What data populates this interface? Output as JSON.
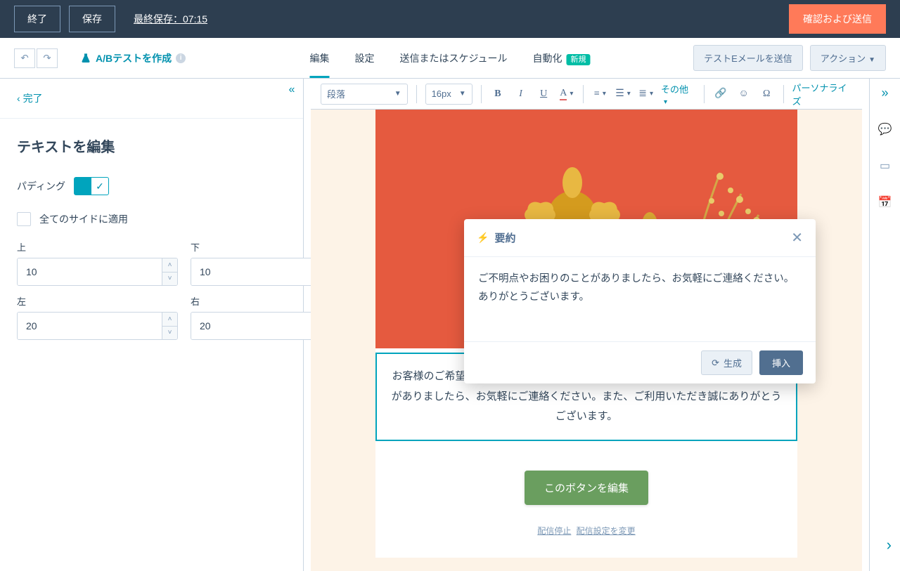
{
  "topbar": {
    "exit": "終了",
    "save": "保存",
    "last_saved": "最終保存：07:15",
    "confirm": "確認および送信"
  },
  "nav": {
    "ab_test": "A/Bテストを作成",
    "tabs": {
      "edit": "編集",
      "settings": "設定",
      "schedule": "送信またはスケジュール",
      "automate": "自動化"
    },
    "new_badge": "新規",
    "test_email": "テストEメールを送信",
    "actions": "アクション"
  },
  "sidebar": {
    "back": "完了",
    "title": "テキストを編集",
    "padding_label": "パディング",
    "apply_all": "全てのサイドに適用",
    "fields": {
      "top": "上",
      "bottom": "下",
      "left": "左",
      "right": "右"
    },
    "values": {
      "top": "10",
      "bottom": "10",
      "left": "20",
      "right": "20"
    }
  },
  "toolbar": {
    "paragraph": "段落",
    "font_size": "16px",
    "more": "その他",
    "personalize": "パーソナライズ"
  },
  "canvas": {
    "text": "お客様のご希望どおりの商品をお届けできれば幸いです。ご不明点やお困りのことがありましたら、お気軽にご連絡ください。また、ご利用いただき誠にありがとうございます。",
    "button": "このボタンを編集",
    "unsubscribe": "配信停止",
    "prefs": "配信設定を変更"
  },
  "popover": {
    "title": "要約",
    "body": "ご不明点やお困りのことがありましたら、お気軽にご連絡ください。ありがとうございます。",
    "generate": "生成",
    "insert": "挿入"
  }
}
